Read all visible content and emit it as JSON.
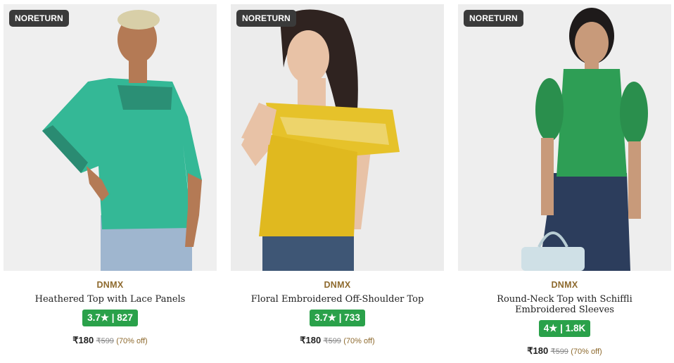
{
  "products": [
    {
      "badge": "NORETURN",
      "brand": "DNMX",
      "name": "Heathered Top with Lace Panels",
      "rating": "3.7★ | 827",
      "price": "₹180",
      "mrp": "₹599",
      "discount": "(70% off)",
      "image": "model-in-teal-top-image",
      "colors": {
        "garment": "#34b896",
        "bg": "#efefef"
      }
    },
    {
      "badge": "NORETURN",
      "brand": "DNMX",
      "name": "Floral Embroidered Off-Shoulder Top",
      "rating": "3.7★ | 733",
      "price": "₹180",
      "mrp": "₹599",
      "discount": "(70% off)",
      "image": "model-in-yellow-top-image",
      "colors": {
        "garment": "#e0b91f",
        "bg": "#ececec"
      }
    },
    {
      "badge": "NORETURN",
      "brand": "DNMX",
      "name": "Round-Neck Top with Schiffli Embroidered Sleeves",
      "rating": "4★ | 1.8K",
      "price": "₹180",
      "mrp": "₹599",
      "discount": "(70% off)",
      "image": "model-in-green-top-image",
      "colors": {
        "garment": "#2e9e55",
        "bg": "#eeeeee"
      }
    }
  ],
  "colors": {
    "badge_bg": "#3a3a3a",
    "brand_text": "#8e6a2e",
    "rating_bg": "#2aa14a"
  }
}
